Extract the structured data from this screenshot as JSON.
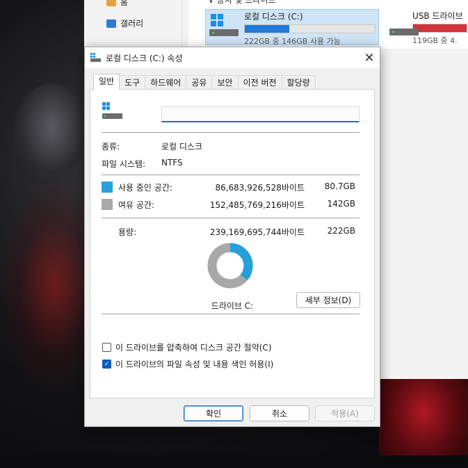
{
  "explorer": {
    "section_head": "∨ 장치 및 드라이브",
    "nav": [
      {
        "label": "홈"
      },
      {
        "label": "갤러리"
      }
    ],
    "drives": [
      {
        "name": "로컬 디스크 (C:)",
        "space": "222GB 중 146GB 사용 가능",
        "used_fraction": 0.34,
        "bar_color": "#1f7ad8"
      },
      {
        "name": "USB 드라이브",
        "space": "119GB 중 4.",
        "used_fraction": 0.96,
        "bar_color": "#d13438"
      }
    ]
  },
  "dialog": {
    "title": "로컬 디스크 (C:) 속성",
    "tabs": [
      "일반",
      "도구",
      "하드웨어",
      "공유",
      "보안",
      "이전 버전",
      "할당량"
    ],
    "active_tab": 0,
    "name_value": "",
    "type_label": "종류:",
    "type_value": "로컬 디스크",
    "fs_label": "파일 시스템:",
    "fs_value": "NTFS",
    "used": {
      "label": "사용 중인 공간:",
      "bytes": "86,683,926,528바이트",
      "size": "80.7GB",
      "color": "#26a0da"
    },
    "free": {
      "label": "여유 공간:",
      "bytes": "152,485,769,216바이트",
      "size": "142GB",
      "color": "#a8a8a8"
    },
    "capacity": {
      "label": "용량:",
      "bytes": "239,169,695,744바이트",
      "size": "222GB"
    },
    "used_fraction": 0.3624,
    "drive_label": "드라이브 C:",
    "detail_button": "세부 정보(D)",
    "compress_label": "이 드라이브를 압축하여 디스크 공간 절약(C)",
    "compress_checked": false,
    "index_label": "이 드라이브의 파일 속성 및 내용 색인 허용(I)",
    "index_checked": true,
    "ok": "확인",
    "cancel": "취소",
    "apply": "적용(A)"
  }
}
